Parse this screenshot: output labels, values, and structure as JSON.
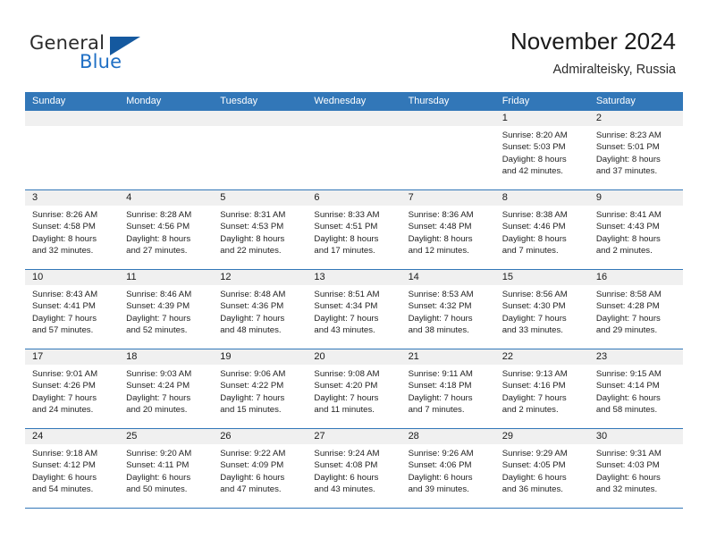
{
  "brand": {
    "word_general": "General",
    "word_blue": "Blue",
    "logo_color": "#15599f",
    "blue_text_color": "#1f6fc4"
  },
  "header": {
    "title": "November 2024",
    "subtitle": "Admiralteisky, Russia"
  },
  "theme": {
    "header_blue": "#3277b8",
    "date_band": "#f0f0f0"
  },
  "weekdays": [
    "Sunday",
    "Monday",
    "Tuesday",
    "Wednesday",
    "Thursday",
    "Friday",
    "Saturday"
  ],
  "weeks": [
    [
      {
        "day": "",
        "sunrise": "",
        "sunset": "",
        "daylight1": "",
        "daylight2": ""
      },
      {
        "day": "",
        "sunrise": "",
        "sunset": "",
        "daylight1": "",
        "daylight2": ""
      },
      {
        "day": "",
        "sunrise": "",
        "sunset": "",
        "daylight1": "",
        "daylight2": ""
      },
      {
        "day": "",
        "sunrise": "",
        "sunset": "",
        "daylight1": "",
        "daylight2": ""
      },
      {
        "day": "",
        "sunrise": "",
        "sunset": "",
        "daylight1": "",
        "daylight2": ""
      },
      {
        "day": "1",
        "sunrise": "Sunrise: 8:20 AM",
        "sunset": "Sunset: 5:03 PM",
        "daylight1": "Daylight: 8 hours",
        "daylight2": "and 42 minutes."
      },
      {
        "day": "2",
        "sunrise": "Sunrise: 8:23 AM",
        "sunset": "Sunset: 5:01 PM",
        "daylight1": "Daylight: 8 hours",
        "daylight2": "and 37 minutes."
      }
    ],
    [
      {
        "day": "3",
        "sunrise": "Sunrise: 8:26 AM",
        "sunset": "Sunset: 4:58 PM",
        "daylight1": "Daylight: 8 hours",
        "daylight2": "and 32 minutes."
      },
      {
        "day": "4",
        "sunrise": "Sunrise: 8:28 AM",
        "sunset": "Sunset: 4:56 PM",
        "daylight1": "Daylight: 8 hours",
        "daylight2": "and 27 minutes."
      },
      {
        "day": "5",
        "sunrise": "Sunrise: 8:31 AM",
        "sunset": "Sunset: 4:53 PM",
        "daylight1": "Daylight: 8 hours",
        "daylight2": "and 22 minutes."
      },
      {
        "day": "6",
        "sunrise": "Sunrise: 8:33 AM",
        "sunset": "Sunset: 4:51 PM",
        "daylight1": "Daylight: 8 hours",
        "daylight2": "and 17 minutes."
      },
      {
        "day": "7",
        "sunrise": "Sunrise: 8:36 AM",
        "sunset": "Sunset: 4:48 PM",
        "daylight1": "Daylight: 8 hours",
        "daylight2": "and 12 minutes."
      },
      {
        "day": "8",
        "sunrise": "Sunrise: 8:38 AM",
        "sunset": "Sunset: 4:46 PM",
        "daylight1": "Daylight: 8 hours",
        "daylight2": "and 7 minutes."
      },
      {
        "day": "9",
        "sunrise": "Sunrise: 8:41 AM",
        "sunset": "Sunset: 4:43 PM",
        "daylight1": "Daylight: 8 hours",
        "daylight2": "and 2 minutes."
      }
    ],
    [
      {
        "day": "10",
        "sunrise": "Sunrise: 8:43 AM",
        "sunset": "Sunset: 4:41 PM",
        "daylight1": "Daylight: 7 hours",
        "daylight2": "and 57 minutes."
      },
      {
        "day": "11",
        "sunrise": "Sunrise: 8:46 AM",
        "sunset": "Sunset: 4:39 PM",
        "daylight1": "Daylight: 7 hours",
        "daylight2": "and 52 minutes."
      },
      {
        "day": "12",
        "sunrise": "Sunrise: 8:48 AM",
        "sunset": "Sunset: 4:36 PM",
        "daylight1": "Daylight: 7 hours",
        "daylight2": "and 48 minutes."
      },
      {
        "day": "13",
        "sunrise": "Sunrise: 8:51 AM",
        "sunset": "Sunset: 4:34 PM",
        "daylight1": "Daylight: 7 hours",
        "daylight2": "and 43 minutes."
      },
      {
        "day": "14",
        "sunrise": "Sunrise: 8:53 AM",
        "sunset": "Sunset: 4:32 PM",
        "daylight1": "Daylight: 7 hours",
        "daylight2": "and 38 minutes."
      },
      {
        "day": "15",
        "sunrise": "Sunrise: 8:56 AM",
        "sunset": "Sunset: 4:30 PM",
        "daylight1": "Daylight: 7 hours",
        "daylight2": "and 33 minutes."
      },
      {
        "day": "16",
        "sunrise": "Sunrise: 8:58 AM",
        "sunset": "Sunset: 4:28 PM",
        "daylight1": "Daylight: 7 hours",
        "daylight2": "and 29 minutes."
      }
    ],
    [
      {
        "day": "17",
        "sunrise": "Sunrise: 9:01 AM",
        "sunset": "Sunset: 4:26 PM",
        "daylight1": "Daylight: 7 hours",
        "daylight2": "and 24 minutes."
      },
      {
        "day": "18",
        "sunrise": "Sunrise: 9:03 AM",
        "sunset": "Sunset: 4:24 PM",
        "daylight1": "Daylight: 7 hours",
        "daylight2": "and 20 minutes."
      },
      {
        "day": "19",
        "sunrise": "Sunrise: 9:06 AM",
        "sunset": "Sunset: 4:22 PM",
        "daylight1": "Daylight: 7 hours",
        "daylight2": "and 15 minutes."
      },
      {
        "day": "20",
        "sunrise": "Sunrise: 9:08 AM",
        "sunset": "Sunset: 4:20 PM",
        "daylight1": "Daylight: 7 hours",
        "daylight2": "and 11 minutes."
      },
      {
        "day": "21",
        "sunrise": "Sunrise: 9:11 AM",
        "sunset": "Sunset: 4:18 PM",
        "daylight1": "Daylight: 7 hours",
        "daylight2": "and 7 minutes."
      },
      {
        "day": "22",
        "sunrise": "Sunrise: 9:13 AM",
        "sunset": "Sunset: 4:16 PM",
        "daylight1": "Daylight: 7 hours",
        "daylight2": "and 2 minutes."
      },
      {
        "day": "23",
        "sunrise": "Sunrise: 9:15 AM",
        "sunset": "Sunset: 4:14 PM",
        "daylight1": "Daylight: 6 hours",
        "daylight2": "and 58 minutes."
      }
    ],
    [
      {
        "day": "24",
        "sunrise": "Sunrise: 9:18 AM",
        "sunset": "Sunset: 4:12 PM",
        "daylight1": "Daylight: 6 hours",
        "daylight2": "and 54 minutes."
      },
      {
        "day": "25",
        "sunrise": "Sunrise: 9:20 AM",
        "sunset": "Sunset: 4:11 PM",
        "daylight1": "Daylight: 6 hours",
        "daylight2": "and 50 minutes."
      },
      {
        "day": "26",
        "sunrise": "Sunrise: 9:22 AM",
        "sunset": "Sunset: 4:09 PM",
        "daylight1": "Daylight: 6 hours",
        "daylight2": "and 47 minutes."
      },
      {
        "day": "27",
        "sunrise": "Sunrise: 9:24 AM",
        "sunset": "Sunset: 4:08 PM",
        "daylight1": "Daylight: 6 hours",
        "daylight2": "and 43 minutes."
      },
      {
        "day": "28",
        "sunrise": "Sunrise: 9:26 AM",
        "sunset": "Sunset: 4:06 PM",
        "daylight1": "Daylight: 6 hours",
        "daylight2": "and 39 minutes."
      },
      {
        "day": "29",
        "sunrise": "Sunrise: 9:29 AM",
        "sunset": "Sunset: 4:05 PM",
        "daylight1": "Daylight: 6 hours",
        "daylight2": "and 36 minutes."
      },
      {
        "day": "30",
        "sunrise": "Sunrise: 9:31 AM",
        "sunset": "Sunset: 4:03 PM",
        "daylight1": "Daylight: 6 hours",
        "daylight2": "and 32 minutes."
      }
    ]
  ]
}
